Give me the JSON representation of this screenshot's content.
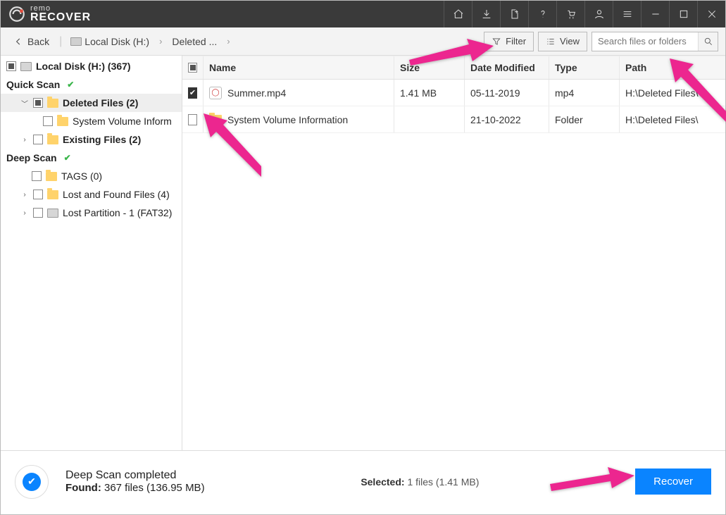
{
  "app": {
    "brand_top": "remo",
    "brand_bottom": "RECOVER"
  },
  "toolbar": {
    "back_label": "Back",
    "crumb1": "Local Disk (H:)",
    "crumb2": "Deleted ...",
    "filter_label": "Filter",
    "view_label": "View",
    "search_placeholder": "Search files or folders"
  },
  "sidebar": {
    "root": "Local Disk (H:) (367)",
    "quick_scan_label": "Quick Scan",
    "deep_scan_label": "Deep Scan",
    "items": [
      {
        "label": "Deleted Files (2)"
      },
      {
        "label": "System Volume Inform"
      },
      {
        "label": "Existing Files (2)"
      },
      {
        "label": "TAGS (0)"
      },
      {
        "label": "Lost and Found Files (4)"
      },
      {
        "label": "Lost Partition - 1 (FAT32)"
      }
    ]
  },
  "table": {
    "headers": {
      "name": "Name",
      "size": "Size",
      "date": "Date Modified",
      "type": "Type",
      "path": "Path"
    },
    "rows": [
      {
        "name": "Summer.mp4",
        "size": "1.41 MB",
        "date": "05-11-2019",
        "type": "mp4",
        "path": "H:\\Deleted Files\\",
        "checked": true,
        "kind": "file"
      },
      {
        "name": "System Volume Information",
        "size": "",
        "date": "21-10-2022",
        "type": "Folder",
        "path": "H:\\Deleted Files\\",
        "checked": false,
        "kind": "folder"
      }
    ]
  },
  "status": {
    "line1": "Deep Scan completed",
    "found_label": "Found:",
    "found_value": "367 files (136.95 MB)",
    "selected_label": "Selected:",
    "selected_value": "1 files (1.41 MB)",
    "recover_label": "Recover"
  }
}
